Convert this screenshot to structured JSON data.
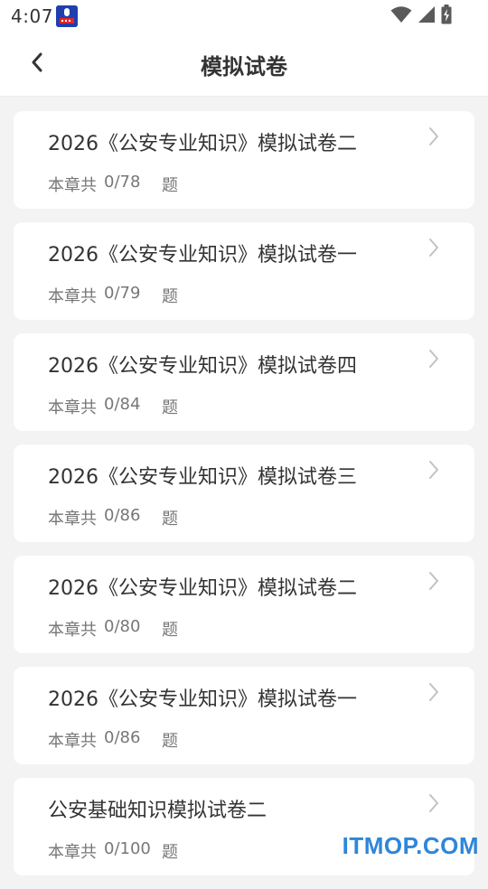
{
  "status_bar": {
    "time": "4:07"
  },
  "header": {
    "title": "模拟试卷"
  },
  "list": {
    "items": [
      {
        "title": "2026《公安专业知识》模拟试卷二",
        "prefix": "本章共",
        "count": "0/78",
        "suffix": "题"
      },
      {
        "title": "2026《公安专业知识》模拟试卷一",
        "prefix": "本章共",
        "count": "0/79",
        "suffix": "题"
      },
      {
        "title": "2026《公安专业知识》模拟试卷四",
        "prefix": "本章共",
        "count": "0/84",
        "suffix": "题"
      },
      {
        "title": "2026《公安专业知识》模拟试卷三",
        "prefix": "本章共",
        "count": "0/86",
        "suffix": "题"
      },
      {
        "title": "2026《公安专业知识》模拟试卷二",
        "prefix": "本章共",
        "count": "0/80",
        "suffix": "题"
      },
      {
        "title": "2026《公安专业知识》模拟试卷一",
        "prefix": "本章共",
        "count": "0/86",
        "suffix": "题"
      },
      {
        "title": "公安基础知识模拟试卷二",
        "prefix": "本章共",
        "count": "0/100",
        "suffix": "题"
      }
    ]
  },
  "watermark": {
    "text": "ITMOP.COM"
  },
  "colors": {
    "background": "#f3f3f3",
    "card": "#ffffff",
    "text_primary": "#333333",
    "text_secondary": "#777777",
    "watermark": "#2f86d8",
    "app_badge": "#1f3fae"
  }
}
